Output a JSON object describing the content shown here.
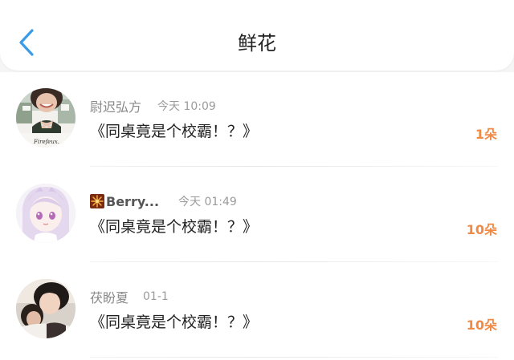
{
  "header": {
    "title": "鲜花",
    "back_icon": "chevron-left-icon",
    "accent_color": "#3a9be8"
  },
  "items": [
    {
      "username": "尉迟弘方",
      "time": "今天 10:09",
      "book": "《同桌竟是个校霸！？》",
      "count": "1朵",
      "avatar_caption": "Firefeux."
    },
    {
      "username": "Berry...",
      "username_icon": "firework-icon",
      "time": "今天 01:49",
      "book": "《同桌竟是个校霸！？》",
      "count": "10朵"
    },
    {
      "username": "茯盼夏",
      "time": "01-1",
      "book": "《同桌竟是个校霸！？》",
      "count": "10朵"
    }
  ],
  "colors": {
    "count": "#f08a45",
    "meta": "#9b9b9b",
    "text": "#222222"
  }
}
